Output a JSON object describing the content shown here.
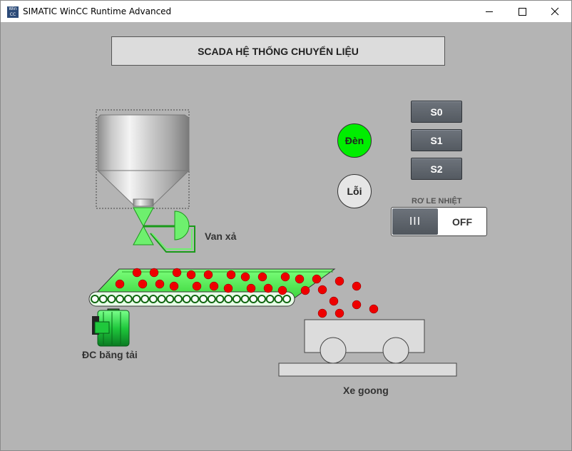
{
  "window": {
    "title": "SIMATIC WinCC Runtime Advanced",
    "icon_text": "WinCC",
    "controls": [
      "minimize-icon",
      "maximize-icon",
      "close-icon"
    ]
  },
  "header": {
    "title": "SCADA HỆ THỐNG CHUYỂN LIỆU"
  },
  "buttons": {
    "s0": "S0",
    "s1": "S1",
    "s2": "S2"
  },
  "lamps": {
    "den": {
      "label": "Đèn",
      "color": "#00ee00"
    },
    "loi": {
      "label": "Lỗi",
      "color": "#e6e6e6"
    }
  },
  "thermal_relay": {
    "label": "RƠ LE NHIỆT",
    "knob_text": "III",
    "state": "OFF"
  },
  "labels": {
    "valve": "Van xả",
    "motor": "ĐC băng tải",
    "cart": "Xe goong"
  },
  "colors": {
    "background": "#b4b4b4",
    "conveyor": "#55ee55",
    "material": "#ee0000",
    "motor": "#22cc44"
  }
}
